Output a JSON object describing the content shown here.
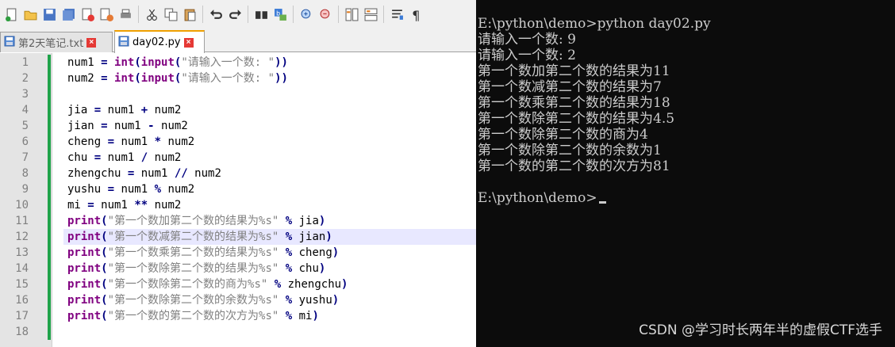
{
  "toolbar": {
    "icons": [
      "new-file-icon",
      "open-folder-icon",
      "save-icon",
      "save-all-icon",
      "close-icon",
      "close-all-icon",
      "print-icon",
      "cut-icon",
      "copy-icon",
      "paste-icon",
      "undo-icon",
      "redo-icon",
      "find-icon",
      "replace-icon",
      "zoom-in-icon",
      "zoom-out-icon",
      "sync-vertical-icon",
      "sync-horizontal-icon",
      "word-wrap-icon",
      "show-all-chars-icon"
    ]
  },
  "tabs": [
    {
      "label": "第2天笔记.txt",
      "active": false
    },
    {
      "label": "day02.py",
      "active": true
    }
  ],
  "editor": {
    "current_line": 12,
    "line_numbers": [
      "1",
      "2",
      "3",
      "4",
      "5",
      "6",
      "7",
      "8",
      "9",
      "10",
      "11",
      "12",
      "13",
      "14",
      "15",
      "16",
      "17",
      "18"
    ],
    "lines": [
      [
        {
          "t": "num1 ",
          "c": ""
        },
        {
          "t": "=",
          "c": "op"
        },
        {
          "t": " ",
          "c": ""
        },
        {
          "t": "int",
          "c": "bi"
        },
        {
          "t": "(",
          "c": "op"
        },
        {
          "t": "input",
          "c": "bi"
        },
        {
          "t": "(",
          "c": "op"
        },
        {
          "t": "\"请输入一个数: \"",
          "c": "str"
        },
        {
          "t": "))",
          "c": "op"
        }
      ],
      [
        {
          "t": "num2 ",
          "c": ""
        },
        {
          "t": "=",
          "c": "op"
        },
        {
          "t": " ",
          "c": ""
        },
        {
          "t": "int",
          "c": "bi"
        },
        {
          "t": "(",
          "c": "op"
        },
        {
          "t": "input",
          "c": "bi"
        },
        {
          "t": "(",
          "c": "op"
        },
        {
          "t": "\"请输入一个数: \"",
          "c": "str"
        },
        {
          "t": "))",
          "c": "op"
        }
      ],
      [],
      [
        {
          "t": "jia ",
          "c": ""
        },
        {
          "t": "=",
          "c": "op"
        },
        {
          "t": " num1 ",
          "c": ""
        },
        {
          "t": "+",
          "c": "op"
        },
        {
          "t": " num2",
          "c": ""
        }
      ],
      [
        {
          "t": "jian ",
          "c": ""
        },
        {
          "t": "=",
          "c": "op"
        },
        {
          "t": " num1 ",
          "c": ""
        },
        {
          "t": "-",
          "c": "op"
        },
        {
          "t": " num2",
          "c": ""
        }
      ],
      [
        {
          "t": "cheng ",
          "c": ""
        },
        {
          "t": "=",
          "c": "op"
        },
        {
          "t": " num1 ",
          "c": ""
        },
        {
          "t": "*",
          "c": "op"
        },
        {
          "t": " num2",
          "c": ""
        }
      ],
      [
        {
          "t": "chu ",
          "c": ""
        },
        {
          "t": "=",
          "c": "op"
        },
        {
          "t": " num1 ",
          "c": ""
        },
        {
          "t": "/",
          "c": "op"
        },
        {
          "t": " num2",
          "c": ""
        }
      ],
      [
        {
          "t": "zhengchu ",
          "c": ""
        },
        {
          "t": "=",
          "c": "op"
        },
        {
          "t": " num1 ",
          "c": ""
        },
        {
          "t": "//",
          "c": "op"
        },
        {
          "t": " num2",
          "c": ""
        }
      ],
      [
        {
          "t": "yushu ",
          "c": ""
        },
        {
          "t": "=",
          "c": "op"
        },
        {
          "t": " num1 ",
          "c": ""
        },
        {
          "t": "%",
          "c": "op"
        },
        {
          "t": " num2",
          "c": ""
        }
      ],
      [
        {
          "t": "mi ",
          "c": ""
        },
        {
          "t": "=",
          "c": "op"
        },
        {
          "t": " num1 ",
          "c": ""
        },
        {
          "t": "**",
          "c": "op"
        },
        {
          "t": " num2",
          "c": ""
        }
      ],
      [
        {
          "t": "print",
          "c": "bi"
        },
        {
          "t": "(",
          "c": "op"
        },
        {
          "t": "\"第一个数加第二个数的结果为%s\"",
          "c": "str"
        },
        {
          "t": " ",
          "c": ""
        },
        {
          "t": "%",
          "c": "op"
        },
        {
          "t": " jia",
          "c": ""
        },
        {
          "t": ")",
          "c": "op"
        }
      ],
      [
        {
          "t": "print",
          "c": "bi"
        },
        {
          "t": "(",
          "c": "op"
        },
        {
          "t": "\"第一个数减第二个数的结果为%s\"",
          "c": "str"
        },
        {
          "t": " ",
          "c": ""
        },
        {
          "t": "%",
          "c": "op"
        },
        {
          "t": " jian",
          "c": ""
        },
        {
          "t": ")",
          "c": "op"
        }
      ],
      [
        {
          "t": "print",
          "c": "bi"
        },
        {
          "t": "(",
          "c": "op"
        },
        {
          "t": "\"第一个数乘第二个数的结果为%s\"",
          "c": "str"
        },
        {
          "t": " ",
          "c": ""
        },
        {
          "t": "%",
          "c": "op"
        },
        {
          "t": " cheng",
          "c": ""
        },
        {
          "t": ")",
          "c": "op"
        }
      ],
      [
        {
          "t": "print",
          "c": "bi"
        },
        {
          "t": "(",
          "c": "op"
        },
        {
          "t": "\"第一个数除第二个数的结果为%s\"",
          "c": "str"
        },
        {
          "t": " ",
          "c": ""
        },
        {
          "t": "%",
          "c": "op"
        },
        {
          "t": " chu",
          "c": ""
        },
        {
          "t": ")",
          "c": "op"
        }
      ],
      [
        {
          "t": "print",
          "c": "bi"
        },
        {
          "t": "(",
          "c": "op"
        },
        {
          "t": "\"第一个数除第二个数的商为%s\"",
          "c": "str"
        },
        {
          "t": " ",
          "c": ""
        },
        {
          "t": "%",
          "c": "op"
        },
        {
          "t": " zhengchu",
          "c": ""
        },
        {
          "t": ")",
          "c": "op"
        }
      ],
      [
        {
          "t": "print",
          "c": "bi"
        },
        {
          "t": "(",
          "c": "op"
        },
        {
          "t": "\"第一个数除第二个数的余数为%s\"",
          "c": "str"
        },
        {
          "t": " ",
          "c": ""
        },
        {
          "t": "%",
          "c": "op"
        },
        {
          "t": " yushu",
          "c": ""
        },
        {
          "t": ")",
          "c": "op"
        }
      ],
      [
        {
          "t": "print",
          "c": "bi"
        },
        {
          "t": "(",
          "c": "op"
        },
        {
          "t": "\"第一个数的第二个数的次方为%s\"",
          "c": "str"
        },
        {
          "t": " ",
          "c": ""
        },
        {
          "t": "%",
          "c": "op"
        },
        {
          "t": " mi",
          "c": ""
        },
        {
          "t": ")",
          "c": "op"
        }
      ],
      []
    ]
  },
  "console": {
    "lines": [
      "E:\\python\\demo>python day02.py",
      "请输入一个数: 9",
      "请输入一个数: 2",
      "第一个数加第二个数的结果为11",
      "第一个数减第二个数的结果为7",
      "第一个数乘第二个数的结果为18",
      "第一个数除第二个数的结果为4.5",
      "第一个数除第二个数的商为4",
      "第一个数除第二个数的余数为1",
      "第一个数的第二个数的次方为81",
      "",
      "E:\\python\\demo>"
    ]
  },
  "watermark": "CSDN @学习时长两年半的虚假CTF选手",
  "colors": {
    "keyword_purple": "#800080",
    "operator_navy": "#000080",
    "string_gray": "#808080",
    "change_bar_green": "#1fa34a",
    "console_bg": "#0c0c0c",
    "console_text": "#cccccc"
  }
}
